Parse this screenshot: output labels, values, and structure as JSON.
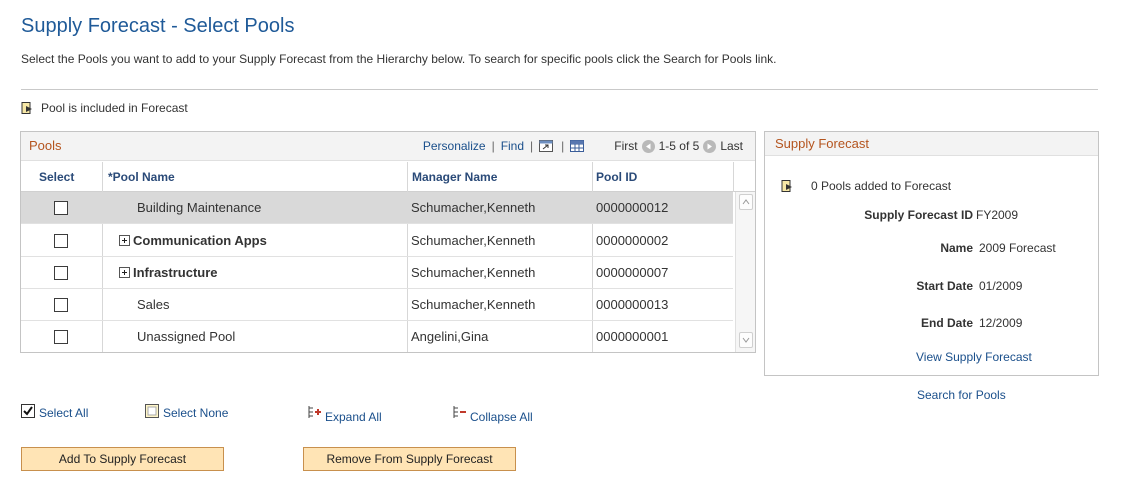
{
  "page": {
    "title": "Supply Forecast - Select Pools",
    "instructions": "Select the Pools you want to add to your Supply Forecast from the Hierarchy below. To search for specific pools click the Search for Pools link.",
    "legend": "Pool is included in Forecast"
  },
  "grid": {
    "caption": "Pools",
    "personalize": "Personalize",
    "find": "Find",
    "first": "First",
    "range": "1-5 of 5",
    "last": "Last",
    "columns": {
      "select": "Select",
      "pool_name": "*Pool Name",
      "manager": "Manager Name",
      "pool_id": "Pool ID"
    },
    "rows": [
      {
        "name": "Building Maintenance",
        "manager": "Schumacher,Kenneth",
        "pool_id": "0000000012",
        "expandable": false,
        "checked": false
      },
      {
        "name": "Communication Apps",
        "manager": "Schumacher,Kenneth",
        "pool_id": "0000000002",
        "expandable": true,
        "checked": false
      },
      {
        "name": "Infrastructure",
        "manager": "Schumacher,Kenneth",
        "pool_id": "0000000007",
        "expandable": true,
        "checked": false
      },
      {
        "name": "Sales",
        "manager": "Schumacher,Kenneth",
        "pool_id": "0000000013",
        "expandable": false,
        "checked": false
      },
      {
        "name": "Unassigned Pool",
        "manager": "Angelini,Gina",
        "pool_id": "0000000001",
        "expandable": false,
        "checked": false
      }
    ]
  },
  "panel": {
    "title": "Supply Forecast",
    "added_text": "0 Pools added to Forecast",
    "fields": {
      "id_label": "Supply Forecast ID",
      "id_value": "FY2009",
      "name_label": "Name",
      "name_value": "2009 Forecast",
      "start_label": "Start Date",
      "start_value": "01/2009",
      "end_label": "End Date",
      "end_value": "12/2009"
    },
    "view_link": "View Supply Forecast"
  },
  "actions": {
    "search_pools": "Search for Pools",
    "select_all": "Select All",
    "select_none": "Select None",
    "expand_all": "Expand All",
    "collapse_all": "Collapse All",
    "add": "Add To Supply Forecast",
    "remove": "Remove From Supply Forecast"
  },
  "colors": {
    "title": "#1f5a98",
    "caption": "#b4541e",
    "link": "#1a4f8b",
    "button_bg": "#ffe4b5",
    "selected_row": "#d9d9d9"
  },
  "icons": [
    "included-in-forecast-icon",
    "zoom-grid-icon",
    "download-icon",
    "first-page-icon",
    "last-page-icon",
    "expand-icon",
    "select-all-icon",
    "select-none-icon",
    "expand-all-icon",
    "collapse-all-icon"
  ]
}
